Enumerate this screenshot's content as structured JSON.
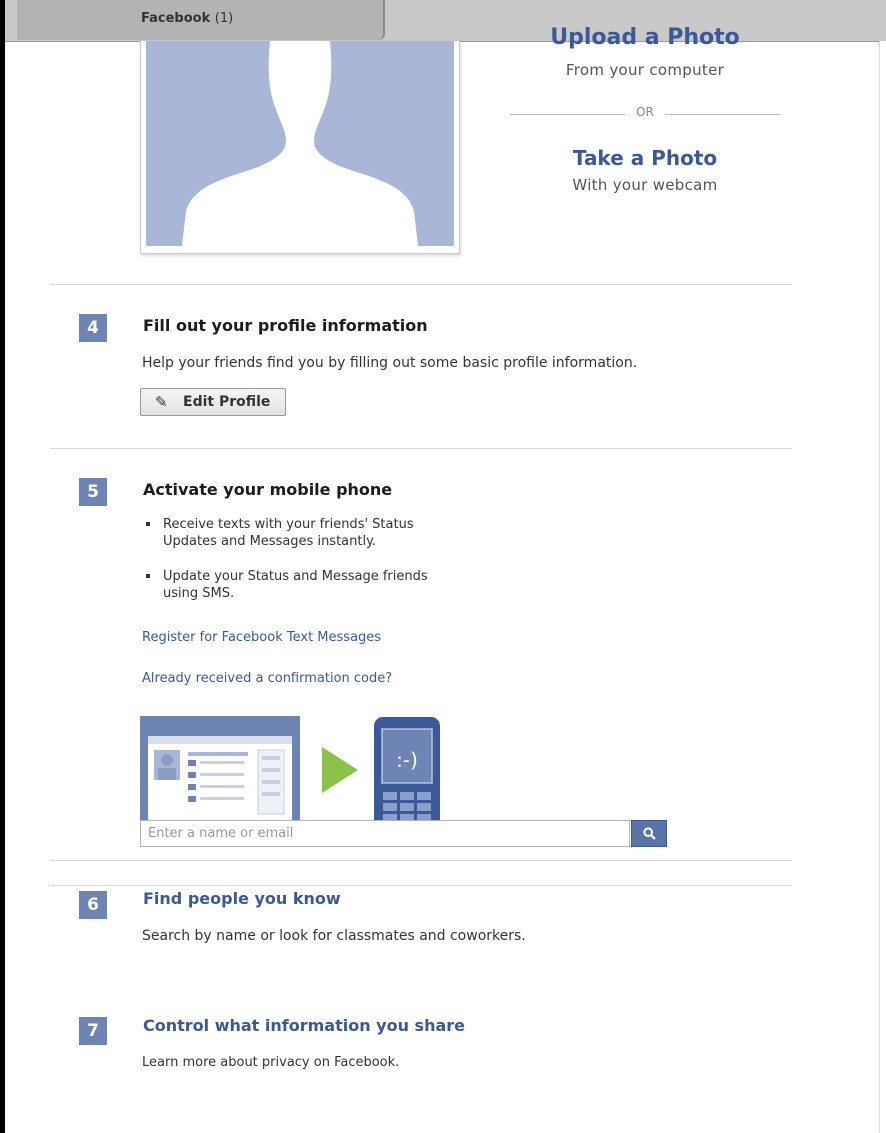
{
  "browser": {
    "tab": {
      "title": "Facebook",
      "count": "(1)"
    }
  },
  "photo": {
    "upload_title": "Upload a Photo",
    "upload_sub": "From your computer",
    "or_label": "OR",
    "take_title": "Take a Photo",
    "take_sub": "With your webcam"
  },
  "steps": {
    "s4": {
      "number": "4",
      "title": "Fill out your profile information",
      "desc": "Help your friends find you by filling out some basic profile information.",
      "button_label": "Edit Profile",
      "button_icon": "pencil-icon"
    },
    "s5": {
      "number": "5",
      "title": "Activate your mobile phone",
      "bullets": [
        "Receive texts with your friends' Status Updates and Messages instantly.",
        "Update your Status and Message friends using SMS."
      ],
      "link1": "Register for Facebook Text Messages",
      "link2": "Already received a confirmation code?",
      "phone_face": ":-)"
    },
    "s6": {
      "number": "6",
      "title": "Find people you know",
      "desc": "Search by name or look for classmates and coworkers.",
      "search_placeholder": "Enter a name or email",
      "search_icon": "search-icon"
    },
    "s7": {
      "number": "7",
      "title": "Control what information you share",
      "desc": "Learn more about privacy on Facebook."
    }
  },
  "colors": {
    "brand_blue": "#3b5998",
    "badge": "#6d84b4",
    "silhouette_bg": "#aab6d8",
    "arrow_green": "#8bc34a"
  }
}
